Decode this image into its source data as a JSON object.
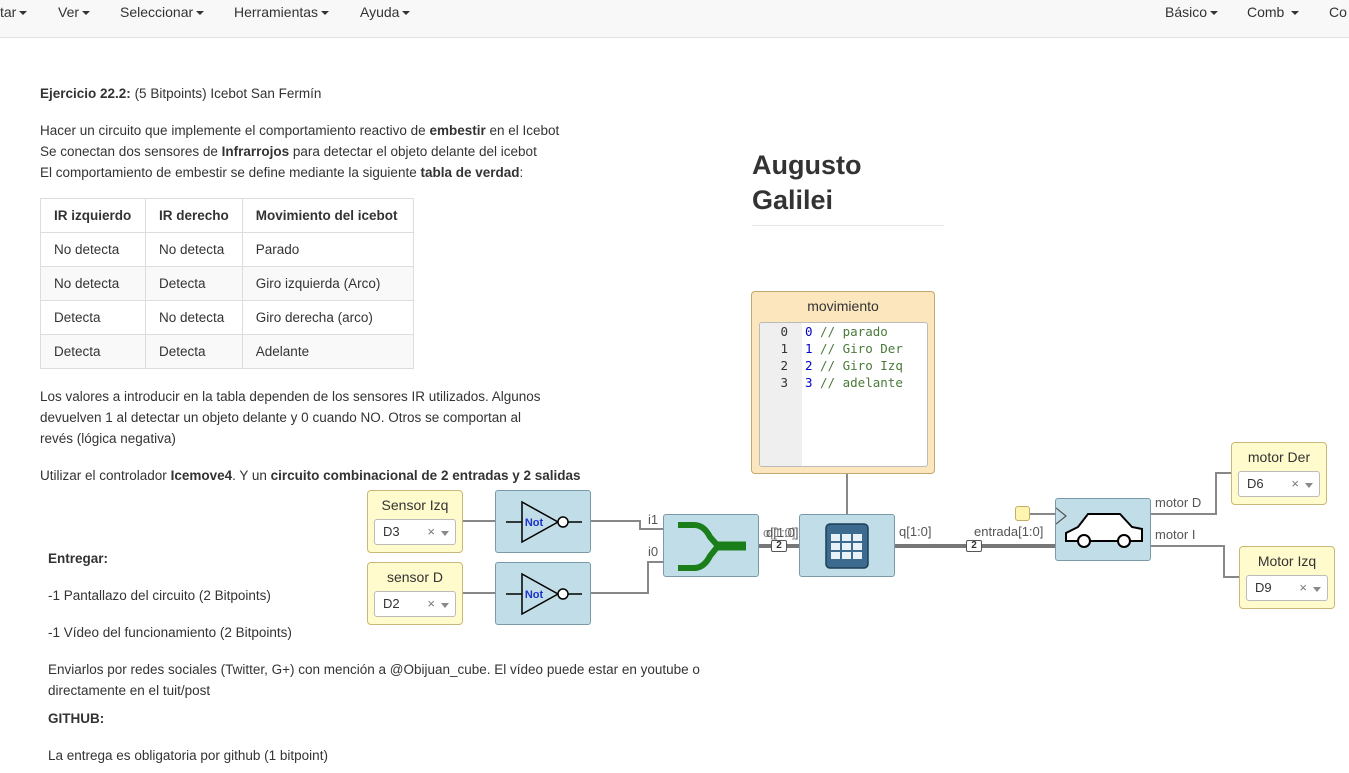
{
  "menu": {
    "left": [
      "tar",
      "Ver",
      "Seleccionar",
      "Herramientas",
      "Ayuda"
    ],
    "right": [
      "Básico",
      "Comb",
      "Co"
    ]
  },
  "exercise": {
    "title_bold": "Ejercicio 22.2:",
    "title_rest": " (5 Bitpoints) Icebot San Fermín",
    "p1_a": "Hacer un circuito que implemente el comportamiento reactivo de ",
    "p1_b": "embestir",
    "p1_c": " en el Icebot",
    "p2_a": "Se conectan dos sensores de ",
    "p2_b": "Infrarrojos",
    "p2_c": " para detectar el objeto delante del icebot",
    "p3_a": "El comportamiento de embestir se define mediante la siguiente ",
    "p3_b": "tabla de verdad",
    "p3_c": ":",
    "table": {
      "headers": [
        "IR izquierdo",
        "IR derecho",
        "Movimiento del icebot"
      ],
      "rows": [
        [
          "No detecta",
          "No detecta",
          "Parado"
        ],
        [
          "No detecta",
          "Detecta",
          "Giro izquierda (Arco)"
        ],
        [
          "Detecta",
          "No detecta",
          "Giro derecha (arco)"
        ],
        [
          "Detecta",
          "Detecta",
          "Adelante"
        ]
      ]
    },
    "p4_l1": "Los valores a introducir en la tabla dependen de los sensores IR utilizados. Algunos",
    "p4_l2": "devuelven 1 al detectar un objeto delante y 0 cuando NO. Otros se comportan al",
    "p4_l3": "revés (lógica negativa)",
    "p5_a": "Utilizar el controlador ",
    "p5_b": "Icemove4",
    "p5_c": ". Y un ",
    "p5_d": "circuito combinacional de 2 entradas y 2 salidas",
    "entregar": "Entregar:",
    "item1": "-1 Pantallazo del circuito (2 Bitpoints)",
    "item2": "-1 Vídeo del funcionamiento (2 Bitpoints)",
    "enviar_l1": "Enviarlos por redes sociales (Twitter, G+) con mención a @Obijuan_cube. El vídeo puede estar en youtube o",
    "enviar_l2": "directamente en el tuit/post",
    "github": "GITHUB:",
    "entrega": "La entrega es obligatoria por github (1 bitpoint)"
  },
  "side_title": {
    "line1": "Augusto",
    "line2": "Galilei"
  },
  "circuit": {
    "sensor_izq": {
      "label": "Sensor Izq",
      "pin": "D3"
    },
    "sensor_d": {
      "label": "sensor D",
      "pin": "D2"
    },
    "not_label": "Not",
    "clear_symbol": "×",
    "joiner_inputs": [
      "i1",
      "i0"
    ],
    "joiner_output": "o[1:0]",
    "mem_input": "d[1:0]",
    "mem_output": "q[1:0]",
    "car_input": "entrada[1:0]",
    "bus_width": "2",
    "memory": {
      "title": "movimiento",
      "lines": [
        {
          "ln": "0",
          "num": "0",
          "comment": " // parado"
        },
        {
          "ln": "1",
          "num": "1",
          "comment": " // Giro Der"
        },
        {
          "ln": "2",
          "num": "2",
          "comment": " // Giro Izq"
        },
        {
          "ln": "3",
          "num": "3",
          "comment": " // adelante"
        }
      ]
    },
    "car_outputs": [
      "motor D",
      "motor I"
    ],
    "motor_der": {
      "label": "motor Der",
      "pin": "D6"
    },
    "motor_izq": {
      "label": "Motor Izq",
      "pin": "D9"
    }
  },
  "colors": {
    "gate_fill": "#c1dde8",
    "io_fill": "#fffbcc",
    "mem_fill": "#fbe6bd",
    "joiner_green": "#1a7f1a",
    "not_text": "#1f33c9"
  }
}
